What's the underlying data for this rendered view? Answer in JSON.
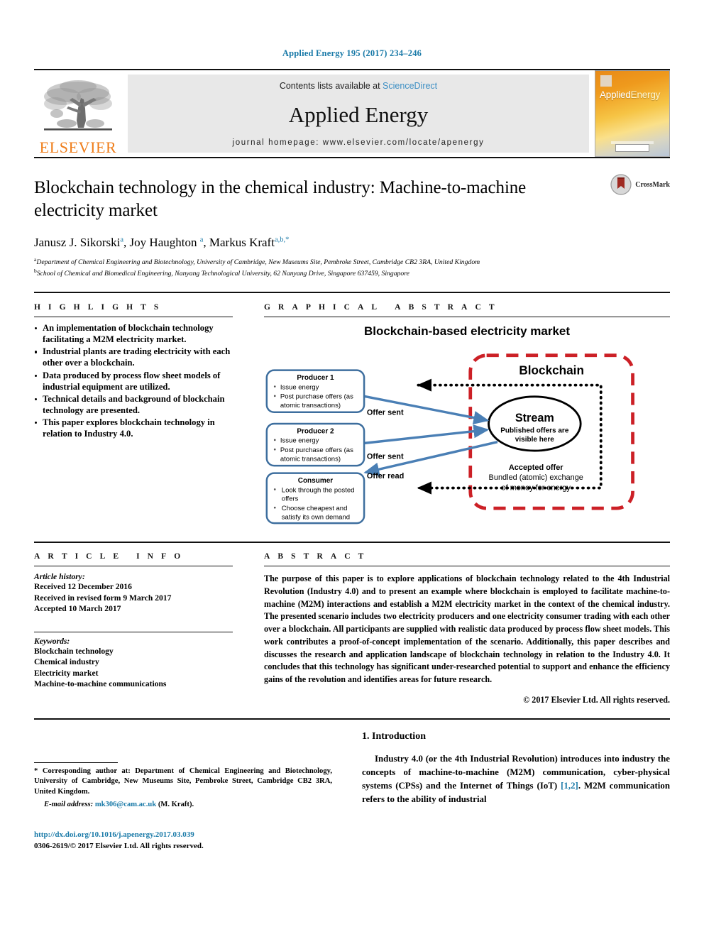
{
  "running_head": "Applied Energy 195 (2017) 234–246",
  "masthead": {
    "publisher_name": "ELSEVIER",
    "contents_prefix": "Contents lists available at ",
    "contents_link": "ScienceDirect",
    "journal_name": "Applied Energy",
    "homepage": "journal homepage: www.elsevier.com/locate/apenergy",
    "cover_title_a": "Applied",
    "cover_title_b": "Energy"
  },
  "title": "Blockchain technology in the chemical industry: Machine-to-machine electricity market",
  "crossmark_label": "CrossMark",
  "authors": [
    {
      "name": "Janusz J. Sikorski",
      "sup": "a",
      "sep": ", "
    },
    {
      "name": "Joy Haughton",
      "sup": "a",
      "sep": ", "
    },
    {
      "name": "Markus Kraft",
      "sup": "a,b,",
      "sep": ""
    }
  ],
  "author_star": "*",
  "affiliations": [
    {
      "mark": "a",
      "text": "Department of Chemical Engineering and Biotechnology, University of Cambridge, New Museums Site, Pembroke Street, Cambridge CB2 3RA, United Kingdom"
    },
    {
      "mark": "b",
      "text": "School of Chemical and Biomedical Engineering, Nanyang Technological University, 62 Nanyang Drive, Singapore 637459, Singapore"
    }
  ],
  "highlights": {
    "heading": "HIGHLIGHTS",
    "items": [
      "An implementation of blockchain technology facilitating a M2M electricity market.",
      "Industrial plants are trading electricity with each other over a blockchain.",
      "Data produced by process flow sheet models of industrial equipment are utilized.",
      "Technical details and background of blockchain technology are presented.",
      "This paper explores blockchain technology in relation to Industry 4.0."
    ]
  },
  "graphical_abstract": {
    "heading": "GRAPHICAL ABSTRACT",
    "figure_title": "Blockchain-based electricity market",
    "boxes": [
      {
        "title": "Producer 1",
        "bullets": [
          "Issue energy",
          "Post purchase offers (as atomic transactions)"
        ]
      },
      {
        "title": "Producer 2",
        "bullets": [
          "Issue energy",
          "Post purchase offers (as atomic transactions)"
        ]
      },
      {
        "title": "Consumer",
        "bullets": [
          "Look through the posted offers",
          "Choose cheapest and satisfy its own demand"
        ]
      }
    ],
    "blockchain_label": "Blockchain",
    "stream_title": "Stream",
    "stream_sub_line1": "Published offers are",
    "stream_sub_line2": "visible here",
    "accepted_title": "Accepted offer",
    "accepted_line1": "Bundled (atomic) exchange",
    "accepted_line2": "of money for energy",
    "edge_labels": [
      "Offer sent",
      "Offer sent",
      "Offer read"
    ],
    "colors": {
      "box_border": "#3d6e9e",
      "arrow_blue": "#4a7fb5",
      "blockchain_red": "#cc2026",
      "dotted_black": "#000000"
    }
  },
  "article_info": {
    "heading": "ARTICLE INFO",
    "history_label": "Article history:",
    "history": [
      "Received 12 December 2016",
      "Received in revised form 9 March 2017",
      "Accepted 10 March 2017"
    ],
    "keywords_label": "Keywords:",
    "keywords": [
      "Blockchain technology",
      "Chemical industry",
      "Electricity market",
      "Machine-to-machine communications"
    ]
  },
  "abstract": {
    "heading": "ABSTRACT",
    "text": "The purpose of this paper is to explore applications of blockchain technology related to the 4th Industrial Revolution (Industry 4.0) and to present an example where blockchain is employed to facilitate machine-to-machine (M2M) interactions and establish a M2M electricity market in the context of the chemical industry. The presented scenario includes two electricity producers and one electricity consumer trading with each other over a blockchain. All participants are supplied with realistic data produced by process flow sheet models. This work contributes a proof-of-concept implementation of the scenario. Additionally, this paper describes and discusses the research and application landscape of blockchain technology in relation to the Industry 4.0. It concludes that this technology has significant under-researched potential to support and enhance the efficiency gains of the revolution and identifies areas for future research.",
    "copyright": "© 2017 Elsevier Ltd. All rights reserved."
  },
  "footnote": {
    "star": "*",
    "corresponding": "Corresponding author at: Department of Chemical Engineering and Biotechnology, University of Cambridge, New Museums Site, Pembroke Street, Cambridge CB2 3RA, United Kingdom.",
    "email_label": "E-mail address:",
    "email": "mk306@cam.ac.uk",
    "email_suffix": "(M. Kraft).",
    "doi_url": "http://dx.doi.org/10.1016/j.apenergy.2017.03.039",
    "issn_line": "0306-2619/© 2017 Elsevier Ltd. All rights reserved."
  },
  "introduction": {
    "heading": "1. Introduction",
    "paragraph_1": "Industry 4.0 (or the 4th Industrial Revolution) introduces into industry the concepts of machine-to-machine (M2M) communication, cyber-physical systems (CPSs) and the Internet of Things (IoT) ",
    "citation_1": "[1,2]",
    "paragraph_1b": ". M2M communication refers to the ability of industrial"
  }
}
